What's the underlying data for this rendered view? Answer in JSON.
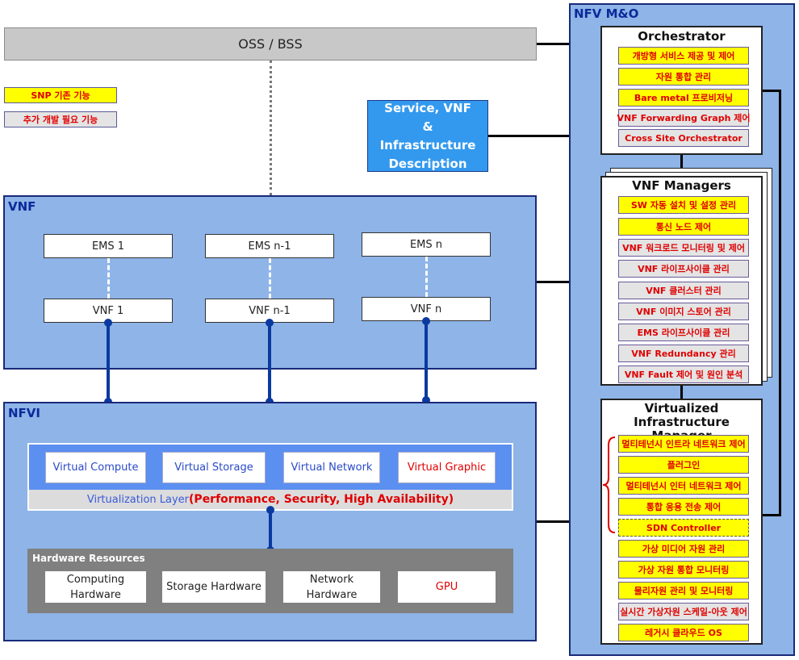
{
  "oss_bss": {
    "label": "OSS / BSS"
  },
  "legend": [
    {
      "label": "SNP 기존 기능",
      "style": "yellow"
    },
    {
      "label": "추가 개발 필요 기능",
      "style": "grey"
    }
  ],
  "description_box": {
    "label": "Service, VNF & Infrastructure Description"
  },
  "vnf_panel": {
    "title": "VNF",
    "ems": [
      "EMS 1",
      "EMS n-1",
      "EMS n"
    ],
    "vnfs": [
      "VNF 1",
      "VNF n-1",
      "VNF n"
    ]
  },
  "nfvi_panel": {
    "title": "NFVI",
    "virtual_resources": [
      {
        "label": "Virtual Compute",
        "color": "#2a4ac8"
      },
      {
        "label": "Virtual Storage",
        "color": "#2a4ac8"
      },
      {
        "label": "Virtual Network",
        "color": "#2a4ac8"
      },
      {
        "label": "Virtual Graphic",
        "color": "#e00000"
      }
    ],
    "virtualization_layer": {
      "prefix": "Virtualization Layer",
      "suffix": "(Performance, Security, High Availability)"
    },
    "hardware": {
      "title": "Hardware Resources",
      "items": [
        {
          "label": "Computing Hardware",
          "color": "#222222"
        },
        {
          "label": "Storage Hardware",
          "color": "#222222"
        },
        {
          "label": "Network Hardware",
          "color": "#222222"
        },
        {
          "label": "GPU",
          "color": "#e00000"
        }
      ]
    }
  },
  "mano": {
    "title": "NFV M&O",
    "orchestrator": {
      "title": "Orchestrator",
      "items": [
        {
          "label": "개방형 서비스 제공 및 제어",
          "style": "yellow"
        },
        {
          "label": "자원 통합 관리",
          "style": "yellow"
        },
        {
          "label": "Bare metal 프로비저닝",
          "style": "yellow"
        },
        {
          "label": "VNF Forwarding Graph 제어",
          "style": "grey"
        },
        {
          "label": "Cross Site Orchestrator",
          "style": "grey"
        }
      ]
    },
    "vnf_managers": {
      "title": "VNF Managers",
      "items": [
        {
          "label": "SW 자동 설치 및 설정 관리",
          "style": "yellow"
        },
        {
          "label": "통신 노드 제어",
          "style": "yellow"
        },
        {
          "label": "VNF 워크로드 모니터링 및 제어",
          "style": "grey"
        },
        {
          "label": "VNF 라이프사이클 관리",
          "style": "grey"
        },
        {
          "label": "VNF 클러스터 관리",
          "style": "grey"
        },
        {
          "label": "VNF 이미지 스토어 관리",
          "style": "grey"
        },
        {
          "label": "EMS 라이프사이클 관리",
          "style": "grey"
        },
        {
          "label": "VNF Redundancy 관리",
          "style": "grey"
        },
        {
          "label": "VNF Fault 제어 및 원인 분석",
          "style": "grey"
        }
      ]
    },
    "vim": {
      "title_line1": "Virtualized",
      "title_line2": "Infrastructure Manager",
      "items": [
        {
          "label": "멀티테넌시 인트라 네트워크 제어",
          "style": "yellow"
        },
        {
          "label": "플러그인",
          "style": "yellow"
        },
        {
          "label": "멀티테넌시 인터 네트워크 제어",
          "style": "yellow"
        },
        {
          "label": "통합 응용 전송 제어",
          "style": "yellow"
        },
        {
          "label": "SDN Controller",
          "style": "yellow dashed"
        },
        {
          "label": "가상 미디어 자원 관리",
          "style": "yellow"
        },
        {
          "label": "가상 자원 통합 모니터링",
          "style": "yellow"
        },
        {
          "label": "물리자원 관리 및 모니터링",
          "style": "yellow"
        },
        {
          "label": "실시간 가상자원 스케일-아웃 제어",
          "style": "grey"
        },
        {
          "label": "레거시 클라우드 OS",
          "style": "yellow"
        }
      ]
    }
  }
}
